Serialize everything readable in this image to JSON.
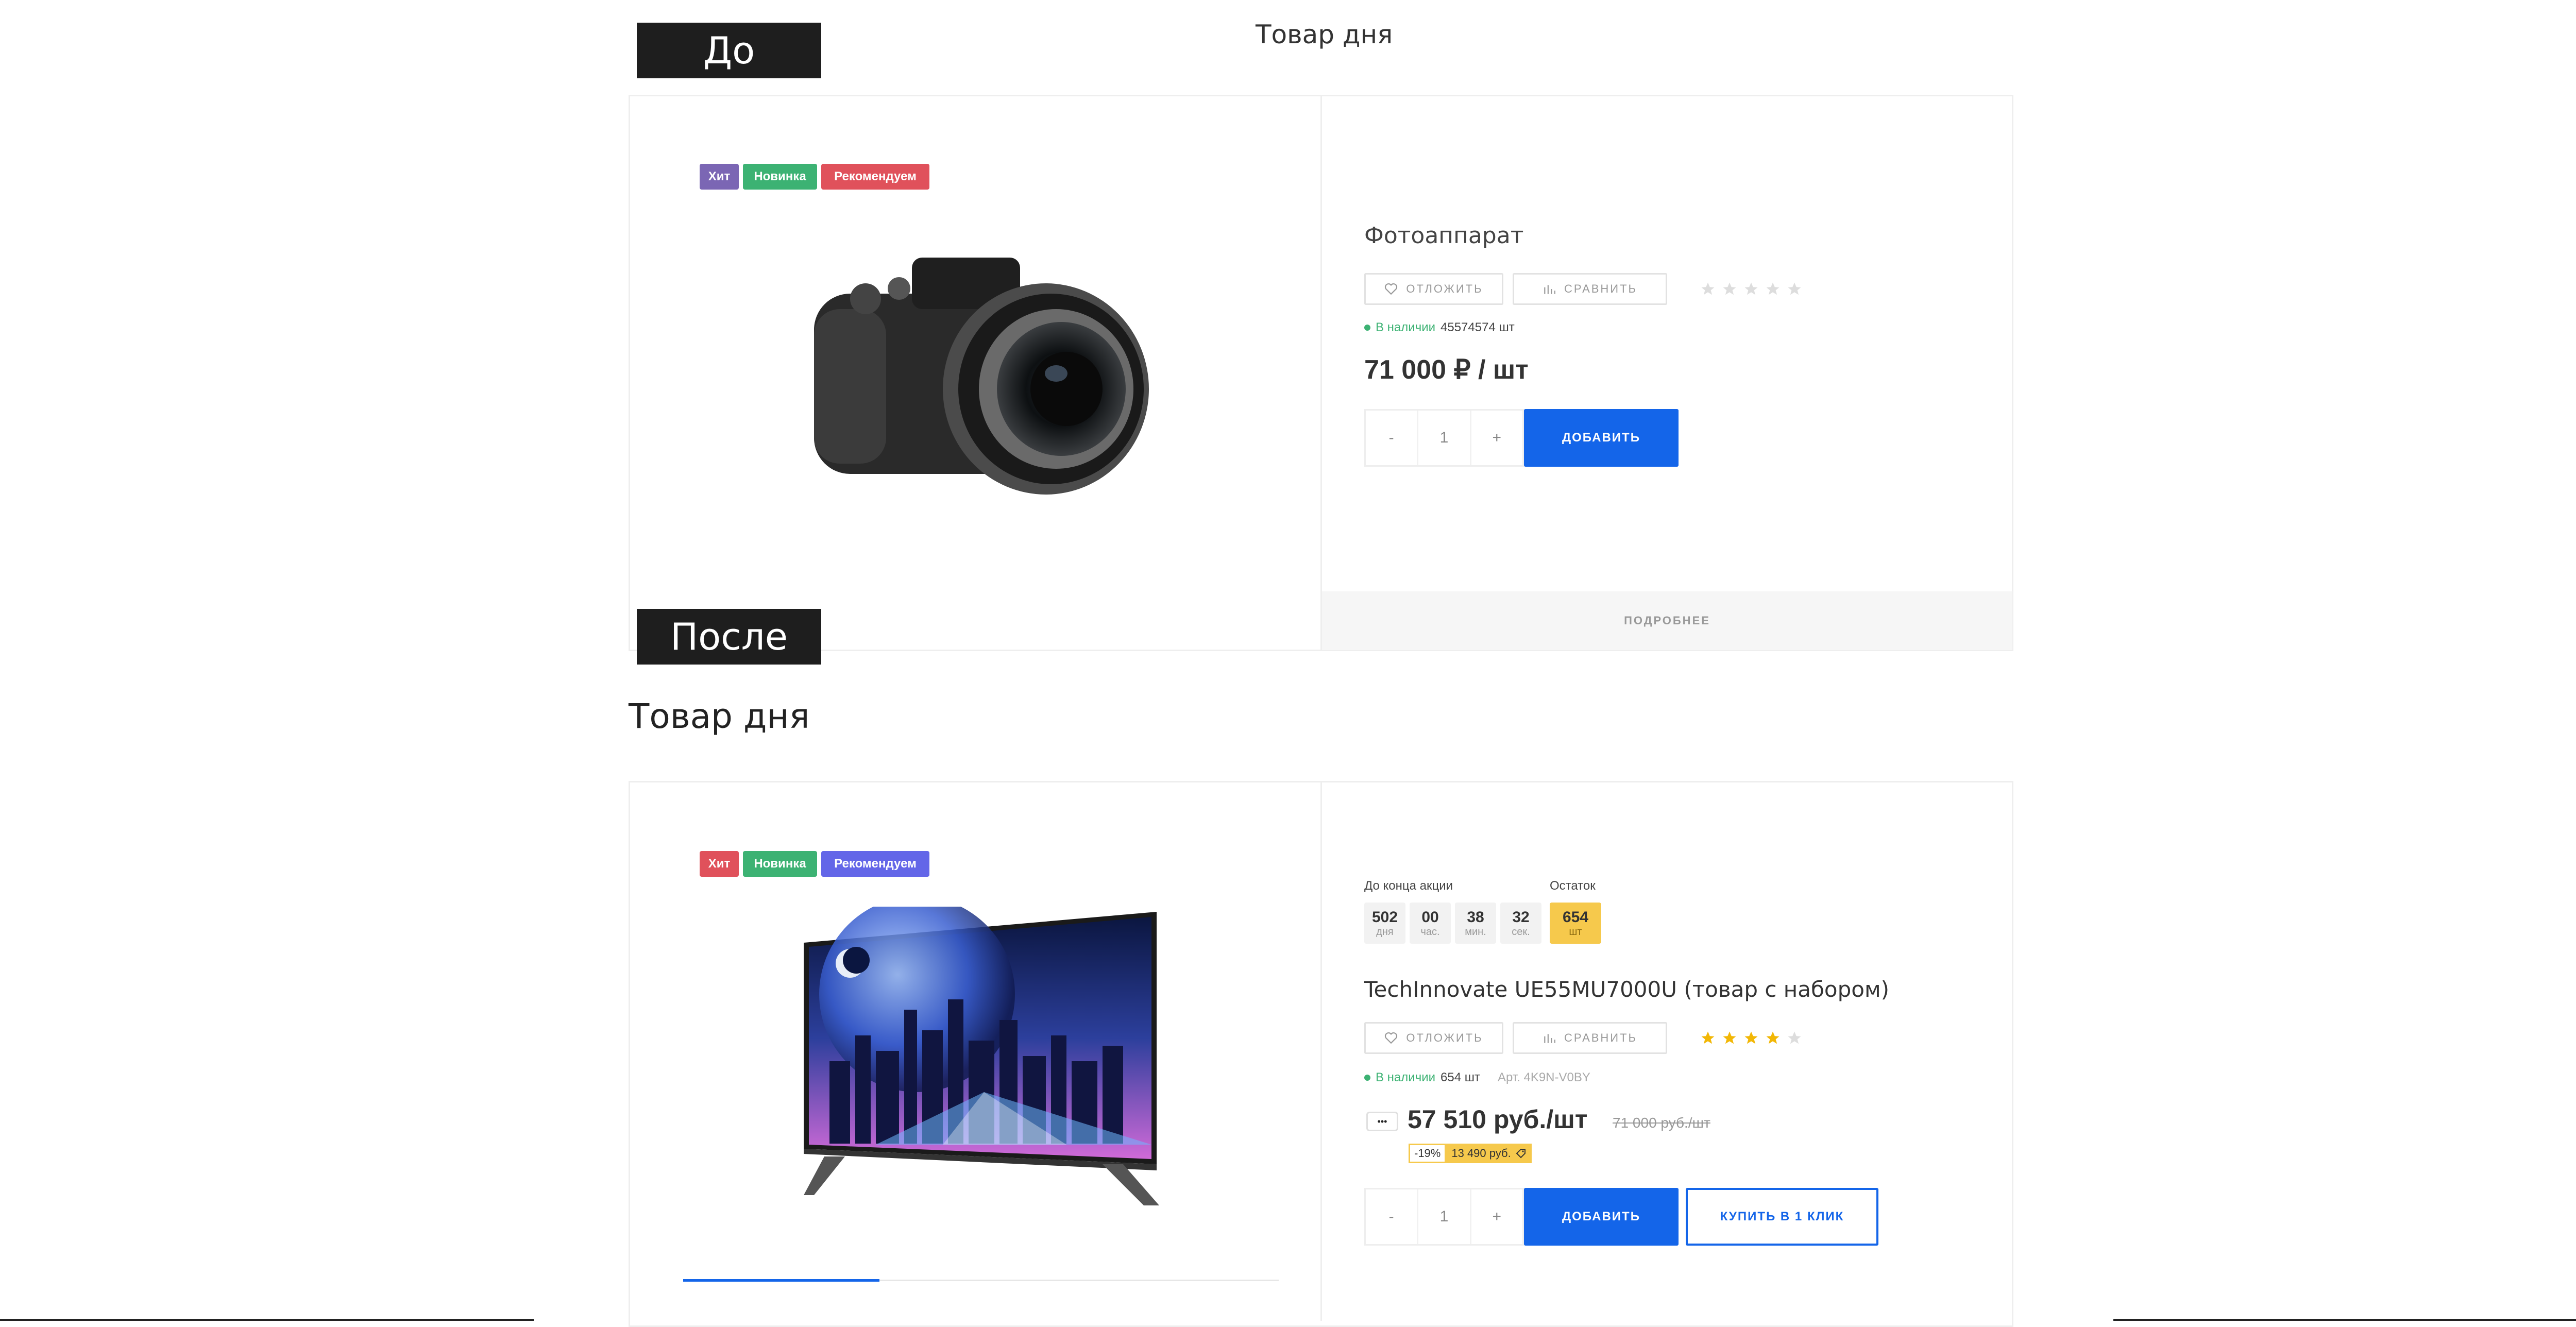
{
  "labels": {
    "before": "До",
    "after": "После"
  },
  "before": {
    "section_title": "Товар дня",
    "badges": [
      {
        "text": "Хит",
        "color": "#7b66b4"
      },
      {
        "text": "Новинка",
        "color": "#3cb273"
      },
      {
        "text": "Рекомендуем",
        "color": "#e0515b"
      }
    ],
    "product_name": "Фотоаппарат",
    "defer_label": "ОТЛОЖИТЬ",
    "compare_label": "СРАВНИТЬ",
    "rating": 0,
    "stock_label": "В наличии",
    "stock_value": "45574574 шт",
    "price": "71 000 ₽ / шт",
    "qty_minus": "-",
    "qty_value": "1",
    "qty_plus": "+",
    "add_label": "ДОБАВИТЬ",
    "more_label": "ПОДРОБНЕЕ"
  },
  "after": {
    "section_title": "Товар дня",
    "badges": [
      {
        "text": "Хит",
        "color": "#e0515b"
      },
      {
        "text": "Новинка",
        "color": "#3cb273"
      },
      {
        "text": "Рекомендуем",
        "color": "#6366e8"
      }
    ],
    "timer_label": "До конца акции",
    "timer": [
      {
        "num": "502",
        "unit": "дня"
      },
      {
        "num": "00",
        "unit": "час."
      },
      {
        "num": "38",
        "unit": "мин."
      },
      {
        "num": "32",
        "unit": "сек."
      }
    ],
    "remaining_label": "Остаток",
    "remaining_num": "654",
    "remaining_unit": "шт",
    "product_name": "TechInnovate UE55MU7000U (товар с набором)",
    "defer_label": "ОТЛОЖИТЬ",
    "compare_label": "СРАВНИТЬ",
    "rating": 4,
    "stock_label": "В наличии",
    "stock_value": "654 шт",
    "article": "Арт. 4K9N-V0BY",
    "more_dots": "•••",
    "price": "57 510 руб./шт",
    "old_price": "71 000 руб./шт",
    "discount": "-19%",
    "saving": "13 490 руб.",
    "qty_minus": "-",
    "qty_value": "1",
    "qty_plus": "+",
    "add_label": "ДОБАВИТЬ",
    "buy_one_click_label": "КУПИТЬ В 1 КЛИК",
    "gallery_progress": 0.33
  },
  "colors": {
    "accent": "#1465e9",
    "green": "#3cb273",
    "star": "#f2b705",
    "star_empty": "#dddddd",
    "highlight": "#f6c94c"
  }
}
